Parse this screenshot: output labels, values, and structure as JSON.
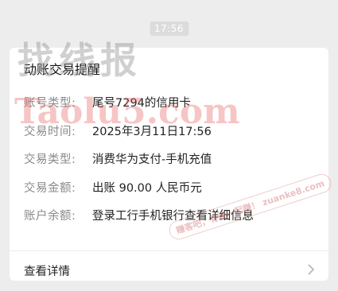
{
  "timestamp": "17:56",
  "card": {
    "title": "动账交易提醒",
    "rows": [
      {
        "label": "账号类型:",
        "value": "尾号7294的信用卡"
      },
      {
        "label": "交易时间:",
        "value": "2025年3月11日17:56"
      },
      {
        "label": "交易类型:",
        "value": "消费华为支付-手机充值"
      },
      {
        "label": "交易金额:",
        "value": "出账 90.00 人民币元"
      },
      {
        "label": "账户余额:",
        "value": "登录工行手机银行查看详细信息"
      }
    ],
    "details_label": "查看详情"
  },
  "watermarks": {
    "big": "找线报",
    "site": "Taolu5.com",
    "stamp": "赚客吧，有我一起赚！ zuanke8.com"
  },
  "icons": {
    "chevron": "chevron-right-icon"
  }
}
